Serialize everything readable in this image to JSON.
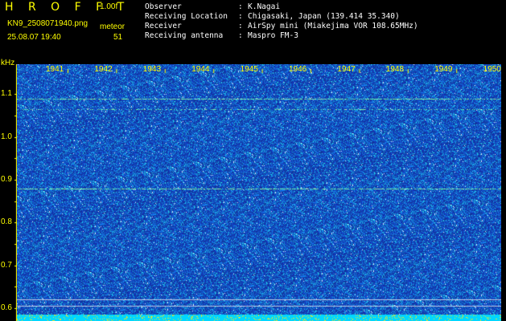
{
  "header": {
    "title": "H R O F F T",
    "version": "1.00f",
    "file_name": "KN9_2508071940.png",
    "timestamp": "25.08.07 19:40",
    "meteor_label": "meteor",
    "meteor_count": "51"
  },
  "info": [
    {
      "label": "Observer",
      "colon": ":",
      "value": "K.Nagai"
    },
    {
      "label": "Receiving Location",
      "colon": ":",
      "value": "Chigasaki, Japan (139.414 35.340)"
    },
    {
      "label": "Receiver",
      "colon": ":",
      "value": "AirSpy mini (Miakejima VOR 108.65MHz)"
    },
    {
      "label": "Receiving antenna",
      "colon": ":",
      "value": "Maspro FM-3"
    }
  ],
  "colors": {
    "accent": "#ffff00",
    "background_blue": "#1a2aa8",
    "bottom_band": "#00d8ff",
    "text": "#ffffff"
  },
  "chart_data": {
    "type": "heatmap",
    "ylabel": "kHz",
    "y_ticks": [
      "1.1",
      "1.0",
      "0.9",
      "0.8",
      "0.7",
      "0.6"
    ],
    "x_ticks": [
      "1941",
      "1942",
      "1943",
      "1944",
      "1945",
      "1946",
      "1947",
      "1948",
      "1949",
      "1950"
    ],
    "echo_lines_khz": [
      1.09,
      1.065,
      0.88
    ],
    "reference_lines_khz": [
      0.62,
      0.605
    ],
    "ylim": [
      0.57,
      1.17
    ]
  }
}
